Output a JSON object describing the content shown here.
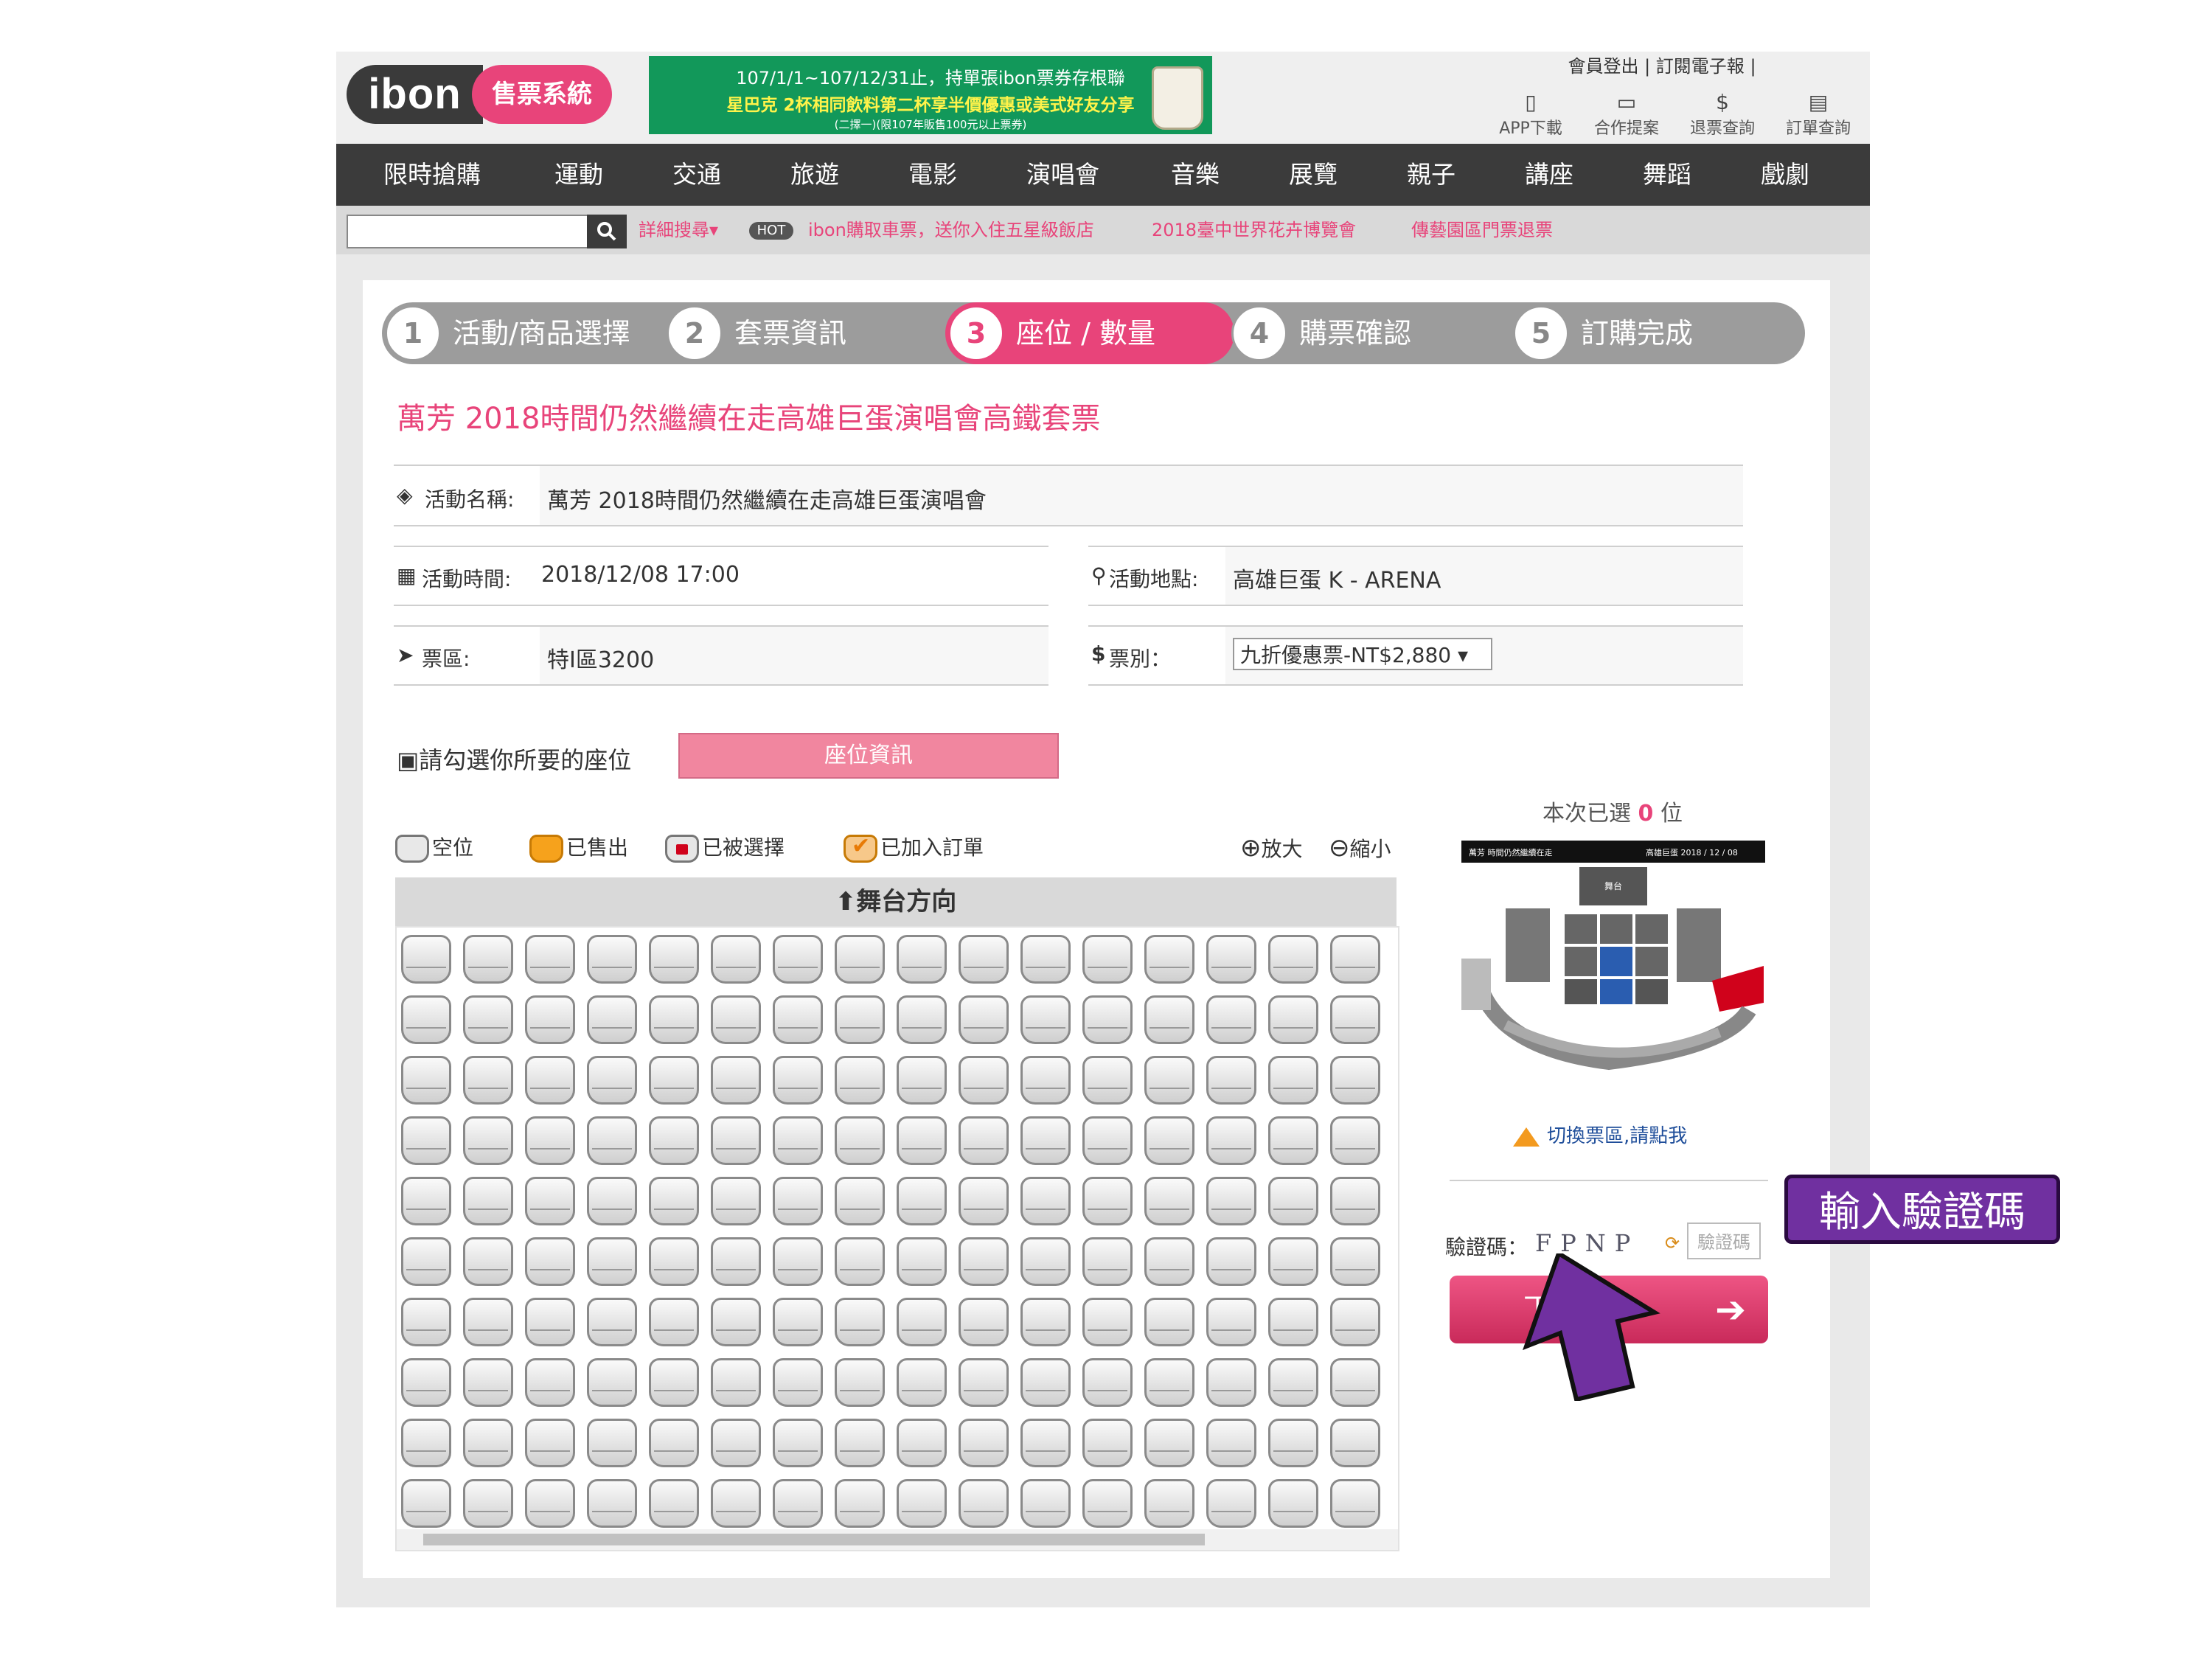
{
  "header": {
    "logo_ibon": "ibon",
    "logo_system": "售票系統",
    "banner": {
      "line1": "107/1/1~107/12/31止，持單張ibon票券存根聯",
      "line2": "星巴克 2杯相同飲料第二杯享半價優惠或美式好友分享",
      "line3": "(二擇一)(限107年販售100元以上票券)"
    },
    "top_links": "會員登出 | 訂閱電子報 |",
    "tools": [
      {
        "label": "APP下載",
        "icon": "phone-icon",
        "glyph": "▯"
      },
      {
        "label": "合作提案",
        "icon": "briefcase-icon",
        "glyph": "▭"
      },
      {
        "label": "退票查詢",
        "icon": "refund-icon",
        "glyph": "$"
      },
      {
        "label": "訂單查詢",
        "icon": "document-icon",
        "glyph": "▤"
      }
    ]
  },
  "nav": [
    "限時搶購",
    "運動",
    "交通",
    "旅遊",
    "電影",
    "演唱會",
    "音樂",
    "展覽",
    "親子",
    "講座",
    "舞蹈",
    "戲劇"
  ],
  "search": {
    "button_glyph": "🔍",
    "advanced": "詳細搜尋▾",
    "hot": "HOT",
    "links": [
      "ibon購取車票，送你入住五星級飯店",
      "2018臺中世界花卉博覽會",
      "傳藝園區門票退票"
    ]
  },
  "steps": [
    {
      "num": "1",
      "label": "活動/商品選擇"
    },
    {
      "num": "2",
      "label": "套票資訊"
    },
    {
      "num": "3",
      "label": "座位 / 數量"
    },
    {
      "num": "4",
      "label": "購票確認"
    },
    {
      "num": "5",
      "label": "訂購完成"
    }
  ],
  "page_title": "萬芳 2018時間仍然繼續在走高雄巨蛋演唱會高鐵套票",
  "fields": {
    "event_name_label": "活動名稱:",
    "event_name": "萬芳 2018時間仍然繼續在走高雄巨蛋演唱會",
    "event_time_label": "活動時間:",
    "event_time": "2018/12/08 17:00",
    "venue_label": "活動地點:",
    "venue": "高雄巨蛋 K - ARENA",
    "area_label": "票區:",
    "area": "特I區3200",
    "ticket_type_label": "票別：",
    "ticket_type": "九折優惠票-NT$2,880 ▾"
  },
  "seat_section": {
    "pick_label": "請勾選你所要的座位",
    "seat_info_button": "座位資訊",
    "legend": [
      "空位",
      "已售出",
      "已被選擇",
      "已加入訂單"
    ],
    "zoom_in": "放大",
    "zoom_out": "縮小",
    "stage": "舞台方向",
    "rows": 10,
    "cols": 16
  },
  "right_panel": {
    "selected_prefix": "本次已選",
    "selected_count": "0",
    "selected_suffix": "位",
    "map_header_left": "萬芳 時間仍然繼續在走",
    "map_header_right": "高雄巨蛋 2018 / 12 / 08",
    "map_stage": "舞台",
    "switch_area": "切換票區,請點我",
    "captcha_label": "驗證碼：",
    "captcha_text": "FPNP",
    "captcha_placeholder": "驗證碼",
    "next_button": "下一步"
  },
  "annotation": {
    "callout": "輸入驗證碼"
  },
  "colors": {
    "brand_pink": "#e8447a",
    "nav_dark": "#3b3b3b",
    "callout_purple": "#7030a0"
  }
}
